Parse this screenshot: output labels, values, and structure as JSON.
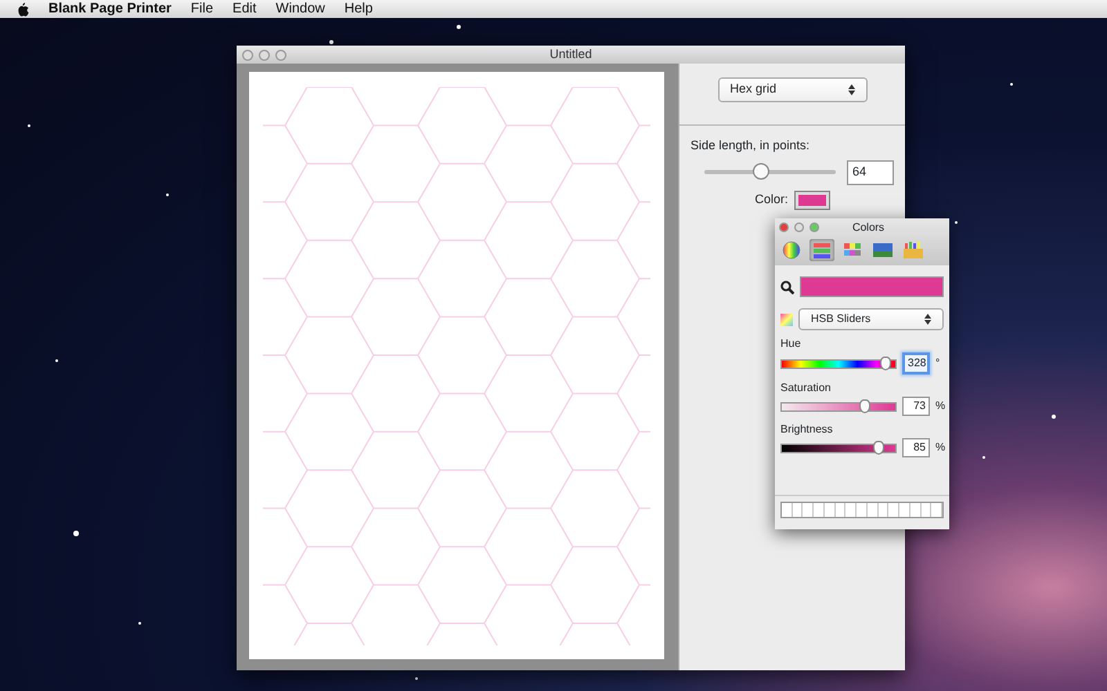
{
  "menu_bar": {
    "app_name": "Blank Page Printer",
    "items": [
      "File",
      "Edit",
      "Window",
      "Help"
    ]
  },
  "document_window": {
    "title": "Untitled",
    "grid_type": "Hex grid",
    "side_length_label": "Side length, in points:",
    "side_length": {
      "level": 0.43,
      "value": "64"
    },
    "color_label": "Color:",
    "color": "#de3a94"
  },
  "colors_panel": {
    "title": "Colors",
    "modes": [
      {
        "kind": "wheel",
        "selected": false
      },
      {
        "kind": "sliders",
        "selected": true
      },
      {
        "kind": "palettes",
        "selected": false
      },
      {
        "kind": "image",
        "selected": false
      },
      {
        "kind": "crayons",
        "selected": false
      }
    ],
    "current_swatch": {
      "color": "#de3a94"
    },
    "slider_mode": "HSB Sliders",
    "sliders": [
      {
        "kind": "hue",
        "label": "Hue",
        "level": 0.91,
        "value": "328",
        "unit": "°",
        "focused": true
      },
      {
        "kind": "saturation",
        "label": "Saturation",
        "level": 0.73,
        "value": "73",
        "unit": "%",
        "focused": false
      },
      {
        "kind": "brightness",
        "label": "Brightness",
        "level": 0.85,
        "value": "85",
        "unit": "%",
        "focused": false
      }
    ]
  }
}
